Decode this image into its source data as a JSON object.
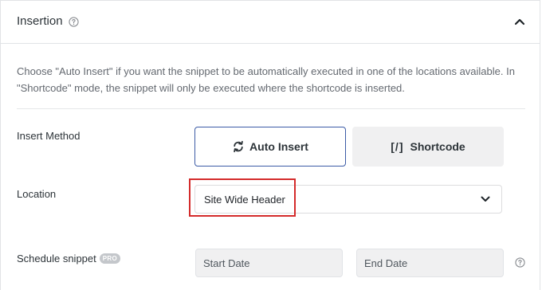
{
  "section": {
    "title": "Insertion",
    "help_icon": "question-circle-icon",
    "collapse_icon": "chevron-up-icon"
  },
  "description": "Choose \"Auto Insert\" if you want the snippet to be automatically executed in one of the locations available. In \"Shortcode\" mode, the snippet will only be executed where the shortcode is inserted.",
  "insert_method": {
    "label": "Insert Method",
    "options": [
      {
        "label": "Auto Insert",
        "icon": "refresh-icon",
        "selected": true
      },
      {
        "label": "Shortcode",
        "icon": "[/]",
        "selected": false
      }
    ]
  },
  "location": {
    "label": "Location",
    "selected_value": "Site Wide Header"
  },
  "schedule": {
    "label": "Schedule snippet",
    "badge": "PRO",
    "start_placeholder": "Start Date",
    "end_placeholder": "End Date"
  },
  "colors": {
    "selected_border": "#3c5ba6",
    "highlight": "#d42b2b",
    "muted_bg": "#f0f0f1"
  }
}
